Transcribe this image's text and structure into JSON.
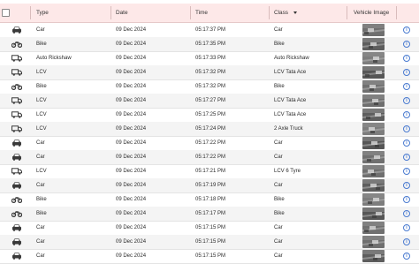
{
  "header": {
    "col_type": "Type",
    "col_date": "Date",
    "col_time": "Time",
    "col_class": "Class",
    "col_image": "Vehicle Image"
  },
  "rows": [
    {
      "icon": "car-icon",
      "type": "Car",
      "date": "09 Dec 2024",
      "time": "05:17:37 PM",
      "class": "Car"
    },
    {
      "icon": "bike-icon",
      "type": "Bike",
      "date": "09 Dec 2024",
      "time": "05:17:35 PM",
      "class": "Bike"
    },
    {
      "icon": "truck-icon",
      "type": "Auto Rickshaw",
      "date": "09 Dec 2024",
      "time": "05:17:33 PM",
      "class": "Auto Rickshaw"
    },
    {
      "icon": "truck-icon",
      "type": "LCV",
      "date": "09 Dec 2024",
      "time": "05:17:32 PM",
      "class": "LCV Tata Ace"
    },
    {
      "icon": "bike-icon",
      "type": "Bike",
      "date": "09 Dec 2024",
      "time": "05:17:32 PM",
      "class": "Bike"
    },
    {
      "icon": "truck-icon",
      "type": "LCV",
      "date": "09 Dec 2024",
      "time": "05:17:27 PM",
      "class": "LCV Tata Ace"
    },
    {
      "icon": "truck-icon",
      "type": "LCV",
      "date": "09 Dec 2024",
      "time": "05:17:25 PM",
      "class": "LCV Tata Ace"
    },
    {
      "icon": "truck-icon",
      "type": "LCV",
      "date": "09 Dec 2024",
      "time": "05:17:24 PM",
      "class": "2 Axle Truck"
    },
    {
      "icon": "car-icon",
      "type": "Car",
      "date": "09 Dec 2024",
      "time": "05:17:22 PM",
      "class": "Car"
    },
    {
      "icon": "car-icon",
      "type": "Car",
      "date": "09 Dec 2024",
      "time": "05:17:22 PM",
      "class": "Car"
    },
    {
      "icon": "truck-icon",
      "type": "LCV",
      "date": "09 Dec 2024",
      "time": "05:17:21 PM",
      "class": "LCV 6 Tyre"
    },
    {
      "icon": "car-icon",
      "type": "Car",
      "date": "09 Dec 2024",
      "time": "05:17:19 PM",
      "class": "Car"
    },
    {
      "icon": "bike-icon",
      "type": "Bike",
      "date": "09 Dec 2024",
      "time": "05:17:18 PM",
      "class": "Bike"
    },
    {
      "icon": "bike-icon",
      "type": "Bike",
      "date": "09 Dec 2024",
      "time": "05:17:17 PM",
      "class": "Bike"
    },
    {
      "icon": "car-icon",
      "type": "Car",
      "date": "09 Dec 2024",
      "time": "05:17:15 PM",
      "class": "Car"
    },
    {
      "icon": "car-icon",
      "type": "Car",
      "date": "09 Dec 2024",
      "time": "05:17:15 PM",
      "class": "Car"
    },
    {
      "icon": "car-icon",
      "type": "Car",
      "date": "09 Dec 2024",
      "time": "05:17:15 PM",
      "class": "Car"
    }
  ],
  "colors": {
    "header_bg": "#fde8e8",
    "info_icon": "#4a7bd0"
  }
}
